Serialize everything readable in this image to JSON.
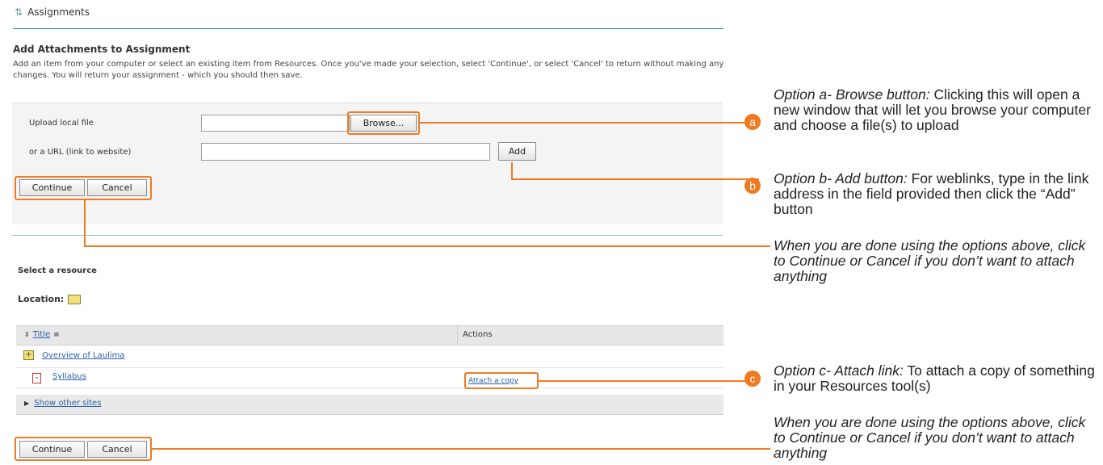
{
  "tool": {
    "icon": "arrows-icon",
    "title": "Assignments"
  },
  "page": {
    "heading": "Add Attachments to Assignment",
    "instructions": "Add an item from your computer or select an existing item from Resources. Once you've made your selection, select 'Continue', or select 'Cancel' to return without making any changes. You will return your assignment - which you should then save."
  },
  "upload": {
    "file_label": "Upload local file",
    "file_value": "",
    "browse_label": "Browse...",
    "url_label": "or a URL (link to website)",
    "url_value": "",
    "add_label": "Add"
  },
  "buttons": {
    "continue_label": "Continue",
    "cancel_label": "Cancel"
  },
  "resources": {
    "select_title": "Select a resource",
    "location_label": "Location:",
    "columns": [
      "Title",
      "Actions"
    ],
    "rows": [
      {
        "title": "Overview of Laulima",
        "icon": "folder-plus-icon",
        "action": ""
      },
      {
        "title": "Syllabus",
        "icon": "pdf-icon",
        "action": "Attach a copy"
      }
    ],
    "show_other_sites": "Show other sites"
  },
  "annotations": {
    "a": {
      "badge": "a",
      "title": "Option a- Browse button:",
      "text": " Clicking this will open a new window that will let you browse your computer and choose a file(s) to upload"
    },
    "b": {
      "badge": "b",
      "title": "Option b- Add button:",
      "text": " For weblinks, type in the link address in the field provided then click the “Add” button"
    },
    "done1": "When you are done using the options above, click to Continue or Cancel if you don’t want to attach anything",
    "c": {
      "badge": "c",
      "title": "Option c- Attach link:",
      "text": " To attach a copy of something in your Resources tool(s)"
    },
    "done2": "When you are done using the options above, click to Continue or Cancel if you don’t want to attach anything"
  },
  "colors": {
    "accent": "#ef7a22",
    "link": "#2a62a8",
    "rule": "#2a8a98"
  }
}
